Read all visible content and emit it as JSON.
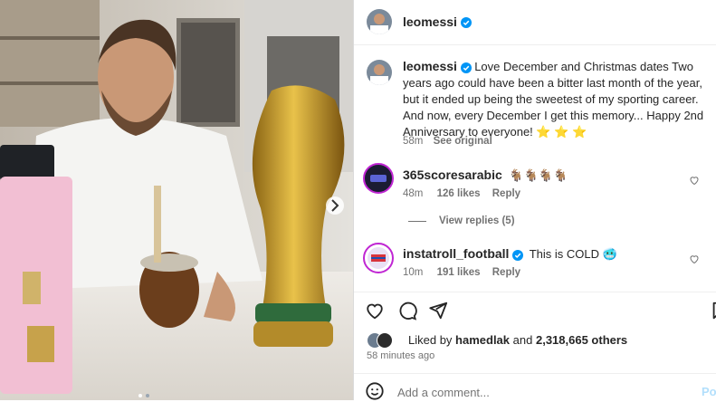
{
  "header": {
    "username": "leomessi"
  },
  "caption": {
    "username": "leomessi",
    "text": "Love December and Christmas dates Two years ago could have been a bitter last month of the year, but it ended up being the sweetest of my sporting career. And now, every December I get this memory... Happy 2nd Anniversary to everyone! ⭐ ⭐ ⭐",
    "time": "58m",
    "see_original": "See original"
  },
  "comments": [
    {
      "username": "365scoresarabic",
      "text": "🐐🐐🐐🐐",
      "time": "48m",
      "likes": "126 likes",
      "reply": "Reply",
      "view_replies": "View replies (5)"
    },
    {
      "username": "instatroll_football",
      "text": "This is COLD 🥶",
      "time": "10m",
      "likes": "191 likes",
      "reply": "Reply"
    }
  ],
  "likes": {
    "prefix": "Liked by",
    "user": "hamedlak",
    "and": "and",
    "others": "2,318,665 others"
  },
  "timestamp": "58 minutes ago",
  "comment_box": {
    "placeholder": "Add a comment...",
    "post": "Po"
  },
  "colors": {
    "verified": "#0095f6",
    "accent": "#0095f6",
    "muted": "#737373"
  }
}
